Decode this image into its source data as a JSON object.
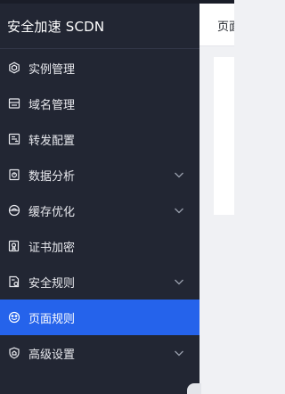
{
  "brand": {
    "title": "安全加速 SCDN"
  },
  "topbar": {
    "title_fragment": "页面"
  },
  "menu": [
    {
      "label": "实例管理",
      "icon": "instance-cube-icon",
      "expandable": false,
      "active": false
    },
    {
      "label": "域名管理",
      "icon": "domain-list-icon",
      "expandable": false,
      "active": false
    },
    {
      "label": "转发配置",
      "icon": "forward-config-icon",
      "expandable": false,
      "active": false
    },
    {
      "label": "数据分析",
      "icon": "data-analysis-icon",
      "expandable": true,
      "active": false
    },
    {
      "label": "缓存优化",
      "icon": "cache-optimize-icon",
      "expandable": true,
      "active": false
    },
    {
      "label": "证书加密",
      "icon": "certificate-icon",
      "expandable": false,
      "active": false
    },
    {
      "label": "安全规则",
      "icon": "security-rule-icon",
      "expandable": true,
      "active": false
    },
    {
      "label": "页面规则",
      "icon": "page-rule-icon",
      "expandable": false,
      "active": true
    },
    {
      "label": "高级设置",
      "icon": "advanced-settings-icon",
      "expandable": true,
      "active": false
    }
  ],
  "colors": {
    "sidebar_bg": "#222633",
    "active_bg": "#2563eb",
    "text": "#ffffff"
  }
}
